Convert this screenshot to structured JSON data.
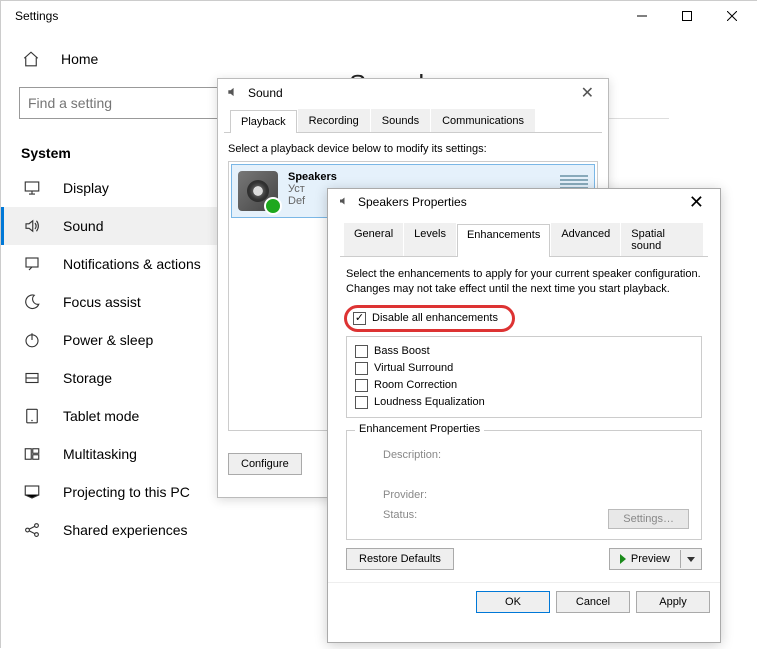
{
  "settings": {
    "window_title": "Settings",
    "home_label": "Home",
    "search_placeholder": "Find a setting",
    "section": "System",
    "nav": [
      "Display",
      "Sound",
      "Notifications & actions",
      "Focus assist",
      "Power & sleep",
      "Storage",
      "Tablet mode",
      "Multitasking",
      "Projecting to this PC",
      "Shared experiences"
    ],
    "page_heading": "Sound"
  },
  "sound_dialog": {
    "title": "Sound",
    "tabs": [
      "Playback",
      "Recording",
      "Sounds",
      "Communications"
    ],
    "instruct": "Select a playback device below to modify its settings:",
    "device": {
      "name": "Speakers",
      "line2": "Уст",
      "line3": "Def"
    },
    "configure": "Configure"
  },
  "props": {
    "title": "Speakers Properties",
    "tabs": [
      "General",
      "Levels",
      "Enhancements",
      "Advanced",
      "Spatial sound"
    ],
    "desc": "Select the enhancements to apply for your current speaker configuration. Changes may not take effect until the next time you start playback.",
    "disable_all": "Disable all enhancements",
    "items": [
      "Bass Boost",
      "Virtual Surround",
      "Room Correction",
      "Loudness Equalization"
    ],
    "group_title": "Enhancement Properties",
    "labels": {
      "description": "Description:",
      "provider": "Provider:",
      "status": "Status:"
    },
    "settings_btn": "Settings…",
    "restore": "Restore Defaults",
    "preview": "Preview",
    "ok": "OK",
    "cancel": "Cancel",
    "apply": "Apply"
  }
}
